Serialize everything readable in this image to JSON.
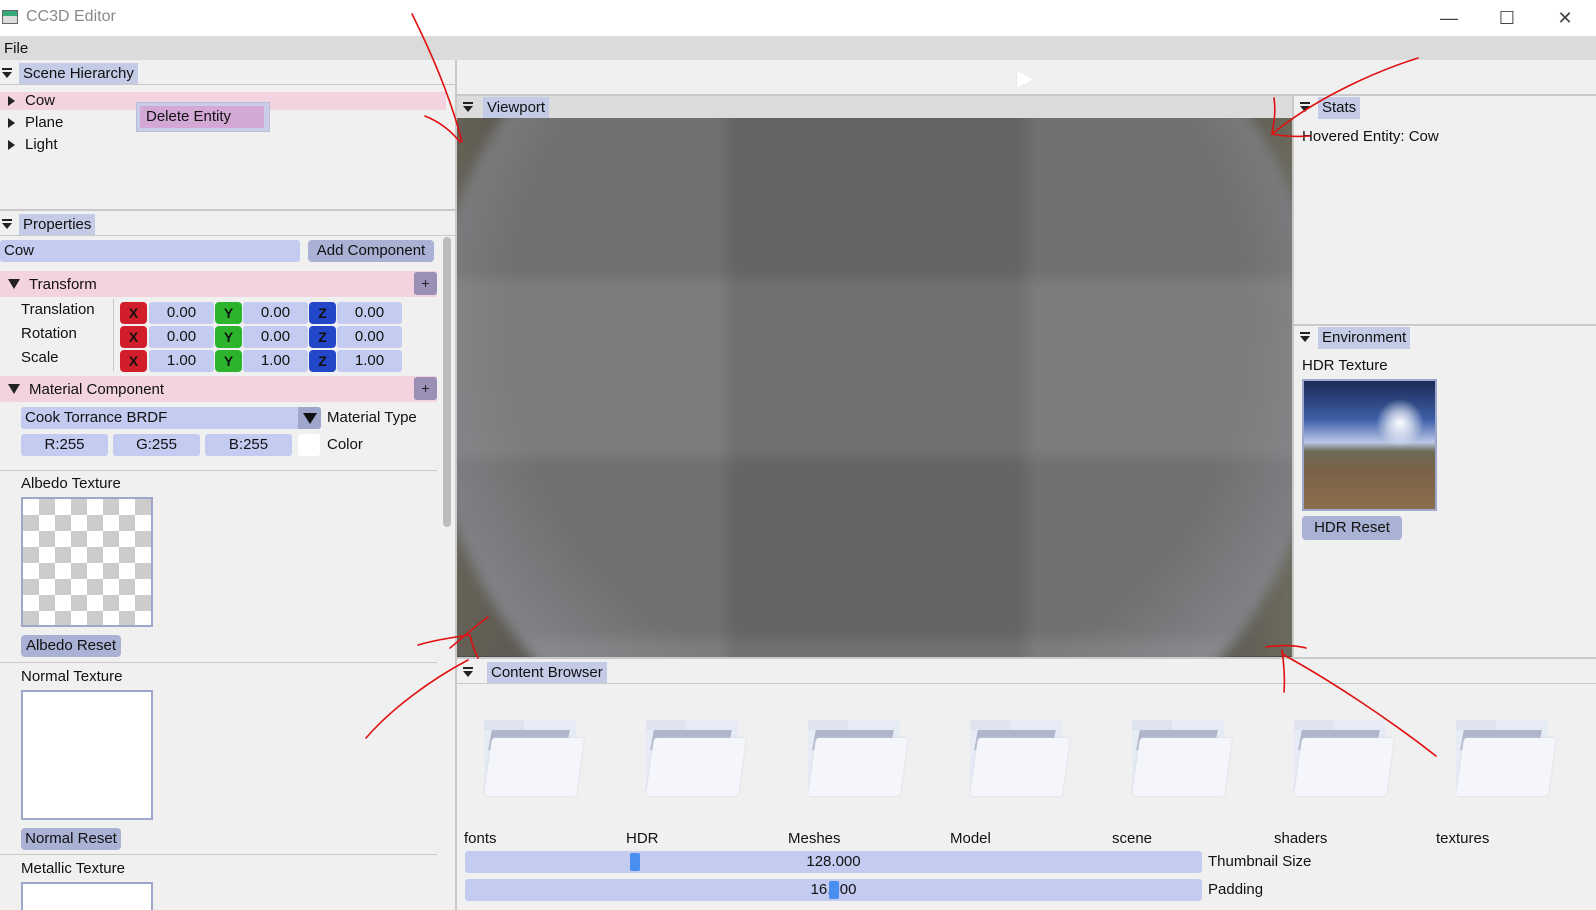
{
  "window": {
    "title": "CC3D Editor",
    "controls": {
      "minimize": "—",
      "maximize": "☐",
      "close": "✕"
    }
  },
  "menu": {
    "file": "File"
  },
  "scene_hierarchy": {
    "title": "Scene Hierarchy",
    "entities": [
      {
        "label": "Cow",
        "selected": true
      },
      {
        "label": "Plane",
        "selected": false
      },
      {
        "label": "Light",
        "selected": false
      }
    ],
    "context_menu": {
      "delete": "Delete Entity"
    }
  },
  "properties": {
    "title": "Properties",
    "entity_name": "Cow",
    "add_component": "Add Component",
    "transform": {
      "title": "Transform",
      "plus": "+",
      "axis": {
        "x": "X",
        "y": "Y",
        "z": "Z"
      },
      "rows": [
        {
          "label": "Translation",
          "x": "0.00",
          "y": "0.00",
          "z": "0.00"
        },
        {
          "label": "Rotation",
          "x": "0.00",
          "y": "0.00",
          "z": "0.00"
        },
        {
          "label": "Scale",
          "x": "1.00",
          "y": "1.00",
          "z": "1.00"
        }
      ]
    },
    "material": {
      "title": "Material Component",
      "plus": "+",
      "type_value": "Cook Torrance BRDF",
      "type_label": "Material Type",
      "r": "R:255",
      "g": "G:255",
      "b": "B:255",
      "color_label": "Color",
      "albedo_label": "Albedo Texture",
      "albedo_reset": "Albedo Reset",
      "normal_label": "Normal Texture",
      "normal_reset": "Normal Reset",
      "metallic_label": "Metallic Texture"
    }
  },
  "viewport": {
    "title": "Viewport",
    "play_icon": "▶"
  },
  "stats": {
    "title": "Stats",
    "hovered": "Hovered Entity: Cow"
  },
  "environment": {
    "title": "Environment",
    "hdr_label": "HDR Texture",
    "hdr_reset": "HDR Reset"
  },
  "content_browser": {
    "title": "Content Browser",
    "folders": [
      "fonts",
      "HDR",
      "Meshes",
      "Model",
      "scene",
      "shaders",
      "textures"
    ],
    "thumbnail_size": {
      "value": "128.000",
      "label": "Thumbnail Size"
    },
    "padding": {
      "value": "16.000",
      "label": "Padding"
    }
  },
  "colors": {
    "tab_bg": "#c3cbe7",
    "selection_pink": "#f2d3df",
    "axis_x": "#d11e2a",
    "axis_y": "#2cb52c",
    "axis_z": "#2446c8",
    "annotation_red": "#e01010"
  }
}
